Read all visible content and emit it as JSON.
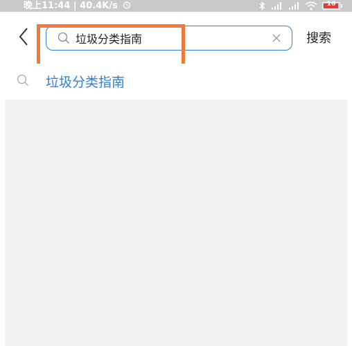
{
  "status_bar": {
    "time_speed": "晚上11:44 | 40.4K/s",
    "alarm_icon": "alarm-clock-icon",
    "bluetooth_icon": "bluetooth-icon",
    "signal_1_icon": "hd-signal-icon",
    "signal_2_icon": "hd-signal-icon",
    "wifi_icon": "wifi-icon",
    "battery_level": "16",
    "battery_color": "#e53935"
  },
  "header": {
    "back_icon": "chevron-left-icon",
    "search": {
      "value": "垃圾分类指南",
      "icon": "search-icon",
      "clear_icon": "close-icon"
    },
    "submit_label": "搜索"
  },
  "suggestions": [
    {
      "icon": "search-icon",
      "text": "垃圾分类指南"
    }
  ],
  "colors": {
    "accent": "#2f7fd8",
    "highlight": "#f07a3a",
    "status_bar_bg": "#c9c9c9",
    "results_bg": "#f2f2f2"
  }
}
